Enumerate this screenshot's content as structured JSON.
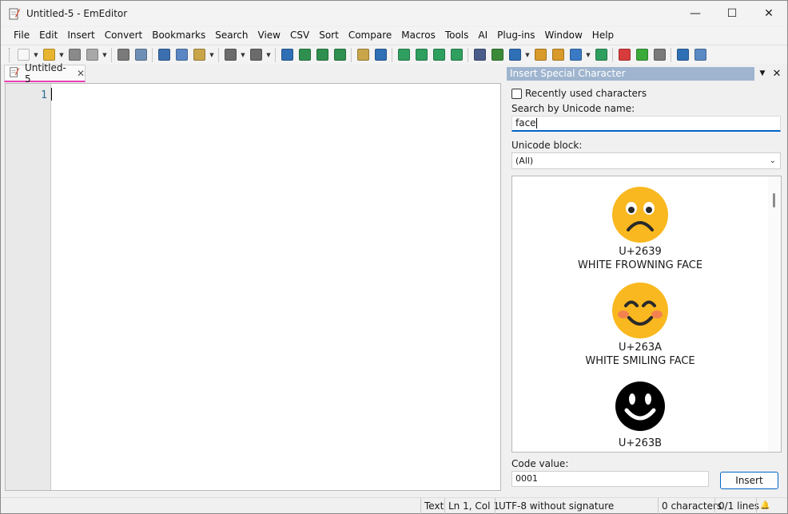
{
  "window": {
    "title": "Untitled-5 - EmEditor",
    "minimize_glyph": "—",
    "maximize_glyph": "☐",
    "close_glyph": "✕"
  },
  "menu": [
    "File",
    "Edit",
    "Insert",
    "Convert",
    "Bookmarks",
    "Search",
    "View",
    "CSV",
    "Sort",
    "Compare",
    "Macros",
    "Tools",
    "AI",
    "Plug-ins",
    "Window",
    "Help"
  ],
  "toolbar": {
    "buttons": [
      {
        "icon": "new-file-icon",
        "color": "#f7f7f7"
      },
      {
        "icon": "open-folder-icon",
        "color": "#e8b531"
      },
      {
        "icon": "save-icon",
        "color": "#8a8a8a"
      },
      {
        "icon": "save-all-icon",
        "color": "#a8a8a8"
      },
      {
        "icon": "print-icon",
        "color": "#7a7a7a"
      },
      {
        "icon": "print-preview-icon",
        "color": "#6e8fb5"
      },
      {
        "icon": "cut-icon",
        "color": "#3b6fb0"
      },
      {
        "icon": "copy-icon",
        "color": "#5a86c4"
      },
      {
        "icon": "paste-icon",
        "color": "#c9a54a"
      },
      {
        "icon": "undo-icon",
        "color": "#6b6b6b"
      },
      {
        "icon": "redo-icon",
        "color": "#6b6b6b"
      },
      {
        "icon": "find-icon",
        "color": "#2f6fb5"
      },
      {
        "icon": "find-next-icon",
        "color": "#2f8f4f"
      },
      {
        "icon": "find-prev-icon",
        "color": "#2f8f4f"
      },
      {
        "icon": "replace-icon",
        "color": "#2f8f4f"
      },
      {
        "icon": "find-in-files-icon",
        "color": "#c9a54a"
      },
      {
        "icon": "filter-icon",
        "color": "#2f6fb5"
      },
      {
        "icon": "word-wrap-icon",
        "color": "#2f9f5f"
      },
      {
        "icon": "wrap-window-icon",
        "color": "#2f9f5f"
      },
      {
        "icon": "wrap-page-icon",
        "color": "#2f9f5f"
      },
      {
        "icon": "no-wrap-icon",
        "color": "#2f9f5f"
      },
      {
        "icon": "spellcheck-icon",
        "color": "#4a5c8a"
      },
      {
        "icon": "clipboard-icon",
        "color": "#3a8a3a"
      },
      {
        "icon": "unicode-icon",
        "color": "#2f6fb5"
      },
      {
        "icon": "marker-icon",
        "color": "#d89a2a"
      },
      {
        "icon": "highlight-icon",
        "color": "#d89a2a"
      },
      {
        "icon": "checkbox-icon",
        "color": "#3a7ac4"
      },
      {
        "icon": "outline-icon",
        "color": "#2f9f5f"
      },
      {
        "icon": "record-macro-icon",
        "color": "#d83b3b"
      },
      {
        "icon": "run-macro-icon",
        "color": "#3aaa3a"
      },
      {
        "icon": "macro-edit-icon",
        "color": "#7a7a7a"
      },
      {
        "icon": "window-icon",
        "color": "#2f6fb5"
      },
      {
        "icon": "customize-icon",
        "color": "#5a8ac4"
      }
    ]
  },
  "tab": {
    "label": "Untitled-5",
    "close_glyph": "✕"
  },
  "editor": {
    "line_number": "1"
  },
  "panel": {
    "title": "Insert Special Character",
    "menu_glyph": "▼",
    "close_glyph": "✕",
    "recently_used_label": "Recently used characters",
    "search_label": "Search by Unicode name:",
    "search_value": "face",
    "block_label": "Unicode block:",
    "block_value": "(All)",
    "block_chevron": "⌄",
    "characters": [
      {
        "code": "U+2639",
        "name": "WHITE FROWNING FACE",
        "style": "frowning",
        "color": "#f9b81f"
      },
      {
        "code": "U+263A",
        "name": "WHITE SMILING FACE",
        "style": "smiling",
        "color": "#f9b81f"
      },
      {
        "code": "U+263B",
        "name": "",
        "style": "black",
        "color": "#000000"
      }
    ],
    "code_label": "Code value:",
    "code_value": "0001",
    "insert_label": "Insert"
  },
  "status": {
    "mode": "Text",
    "position": "Ln 1, Col 1",
    "encoding": "UTF-8 without signature",
    "chars": "0 characters",
    "lines": "0/1 lines",
    "bell_glyph": "🔔"
  }
}
